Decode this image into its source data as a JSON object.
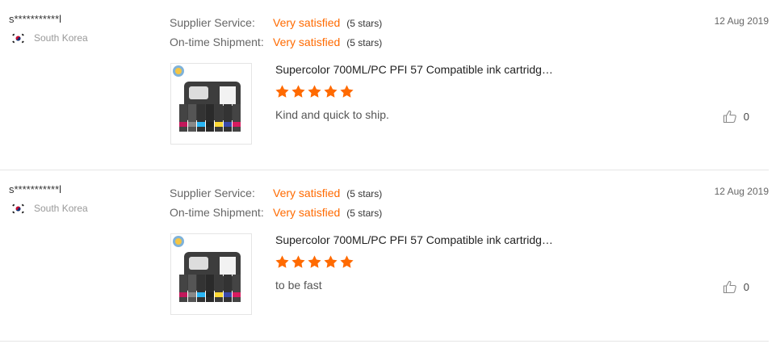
{
  "reviews": [
    {
      "buyer": "s***********l",
      "country": "South Korea",
      "date": "12 Aug 2019",
      "ratings": [
        {
          "label": "Supplier Service:",
          "value": "Very satisfied",
          "stars": "(5 stars)"
        },
        {
          "label": "On-time Shipment:",
          "value": "Very satisfied",
          "stars": "(5 stars)"
        }
      ],
      "product_title": "Supercolor 700ML/PC PFI 57 Compatible ink cartridg…",
      "star_count": 5,
      "feedback": "Kind and quick to ship.",
      "likes": "0"
    },
    {
      "buyer": "s***********l",
      "country": "South Korea",
      "date": "12 Aug 2019",
      "ratings": [
        {
          "label": "Supplier Service:",
          "value": "Very satisfied",
          "stars": "(5 stars)"
        },
        {
          "label": "On-time Shipment:",
          "value": "Very satisfied",
          "stars": "(5 stars)"
        }
      ],
      "product_title": "Supercolor 700ML/PC PFI 57 Compatible ink cartridg…",
      "star_count": 5,
      "feedback": "to be fast",
      "likes": "0"
    }
  ],
  "colors": {
    "accent": "#ff6a00",
    "muted": "#999999",
    "divider": "#e6e6e6"
  },
  "icons": {
    "flag": "south-korea-flag-icon",
    "star": "star-icon",
    "like": "thumbs-up-icon",
    "product": "ink-cartridge-set-image"
  }
}
